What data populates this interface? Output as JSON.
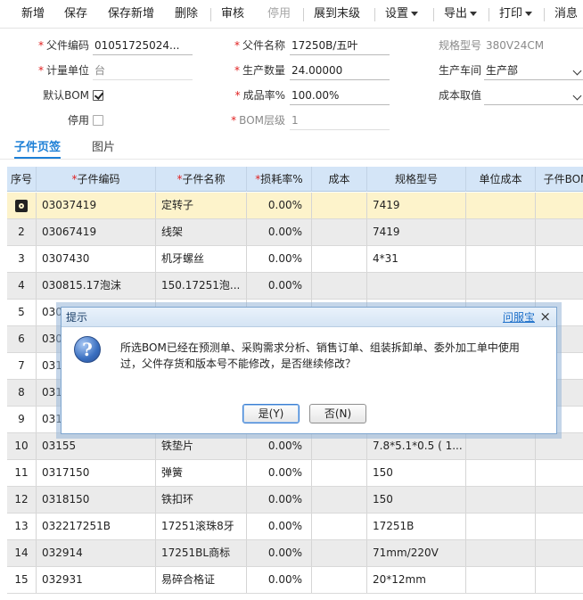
{
  "toolbar": {
    "add": "新增",
    "save": "保存",
    "save_new": "保存新增",
    "delete": "删除",
    "audit": "审核",
    "disable": "停用",
    "expand": "展到末级",
    "settings": "设置",
    "export": "导出",
    "print": "打印",
    "message": "消息"
  },
  "form": {
    "parent_code": {
      "label": "父件编码",
      "value": "01051725024..."
    },
    "parent_name": {
      "label": "父件名称",
      "value": "17250B/五叶"
    },
    "spec": {
      "label": "规格型号",
      "value": "380V24CM"
    },
    "unit": {
      "label": "计量单位",
      "value": "台"
    },
    "quantity": {
      "label": "生产数量",
      "value": "24.00000"
    },
    "workshop": {
      "label": "生产车间",
      "value": "生产部"
    },
    "default_bom": {
      "label": "默认BOM",
      "checked": true
    },
    "yield": {
      "label": "成品率%",
      "value": "100.00%"
    },
    "cost_value": {
      "label": "成本取值",
      "value": ""
    },
    "disabled": {
      "label": "停用",
      "checked": false
    },
    "bom_level": {
      "label": "BOM层级",
      "value": "1"
    }
  },
  "tabs": [
    "子件页签",
    "图片"
  ],
  "grid": {
    "headers": [
      "序号",
      "子件编码",
      "子件名称",
      "损耗率%",
      "成本",
      "规格型号",
      "单位成本",
      "子件BOM"
    ],
    "required": [
      false,
      true,
      true,
      true,
      false,
      false,
      false,
      false
    ],
    "rows": [
      {
        "no": "",
        "code": "03037419",
        "name": "定转子",
        "loss": "0.00%",
        "cost": "",
        "spec": "7419",
        "unit_cost": "",
        "bom": ""
      },
      {
        "no": "2",
        "code": "03067419",
        "name": "线架",
        "loss": "0.00%",
        "cost": "",
        "spec": "7419",
        "unit_cost": "",
        "bom": ""
      },
      {
        "no": "3",
        "code": "0307430",
        "name": "机牙螺丝",
        "loss": "0.00%",
        "cost": "",
        "spec": "4*31",
        "unit_cost": "",
        "bom": ""
      },
      {
        "no": "4",
        "code": "030815.17泡沫",
        "name": "150.17251泡...",
        "loss": "0.00%",
        "cost": "",
        "spec": "",
        "unit_cost": "",
        "bom": ""
      },
      {
        "no": "5",
        "code": "030",
        "name": "",
        "loss": "",
        "cost": "",
        "spec": "",
        "unit_cost": "",
        "bom": ""
      },
      {
        "no": "6",
        "code": "030",
        "name": "",
        "loss": "",
        "cost": "",
        "spec": "",
        "unit_cost": "",
        "bom": ""
      },
      {
        "no": "7",
        "code": "031",
        "name": "",
        "loss": "",
        "cost": "",
        "spec": "",
        "unit_cost": "",
        "bom": ""
      },
      {
        "no": "8",
        "code": "031",
        "name": "",
        "loss": "",
        "cost": "",
        "spec": "",
        "unit_cost": "",
        "bom": ""
      },
      {
        "no": "9",
        "code": "031",
        "name": "",
        "loss": "",
        "cost": "",
        "spec": "",
        "unit_cost": "",
        "bom": ""
      },
      {
        "no": "10",
        "code": "03155",
        "name": "铁垫片",
        "loss": "0.00%",
        "cost": "",
        "spec": "7.8*5.1*0.5 ( 1...",
        "unit_cost": "",
        "bom": ""
      },
      {
        "no": "11",
        "code": "0317150",
        "name": "弹簧",
        "loss": "0.00%",
        "cost": "",
        "spec": "150",
        "unit_cost": "",
        "bom": ""
      },
      {
        "no": "12",
        "code": "0318150",
        "name": "铁扣环",
        "loss": "0.00%",
        "cost": "",
        "spec": "150",
        "unit_cost": "",
        "bom": ""
      },
      {
        "no": "13",
        "code": "032217251B",
        "name": "17251滚珠8牙",
        "loss": "0.00%",
        "cost": "",
        "spec": "17251B",
        "unit_cost": "",
        "bom": ""
      },
      {
        "no": "14",
        "code": "032914",
        "name": "17251BL商标",
        "loss": "0.00%",
        "cost": "",
        "spec": "71mm/220V",
        "unit_cost": "",
        "bom": ""
      },
      {
        "no": "15",
        "code": "032931",
        "name": "易碎合格证",
        "loss": "0.00%",
        "cost": "",
        "spec": "20*12mm",
        "unit_cost": "",
        "bom": ""
      }
    ]
  },
  "dialog": {
    "title": "提示",
    "help": "问服宝",
    "close": "×",
    "icon": "question-icon",
    "icon_glyph": "?",
    "message": "所选BOM已经在预测单、采购需求分析、销售订单、组装拆卸单、委外加工单中使用过，父件存货和版本号不能修改，是否继续修改？",
    "yes": "是(Y)",
    "no": "否(N)"
  }
}
